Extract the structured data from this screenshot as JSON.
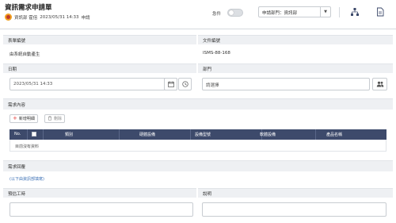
{
  "header": {
    "title": "資訊需求申請單",
    "user": "資訊部 霍倍",
    "datetime": "2023/05/31 14:33",
    "action": "申請",
    "urgent_label": "急件",
    "urgent_on": false,
    "dept_select": "申請部門：資訊部",
    "icons": [
      "org-chart-icon",
      "document-icon"
    ]
  },
  "fields": {
    "form_no_label": "表單編號",
    "form_no_value": "由系統自動產生",
    "doc_no_label": "文件編號",
    "doc_no_value": "ISMS-88-168",
    "date_label": "日期",
    "date_value": "2023/05/31 14:33",
    "dept_label": "部門",
    "dept_placeholder": "請選擇"
  },
  "request": {
    "section_label": "需求內容",
    "add_button": "新增明細",
    "delete_button": "刪除",
    "columns": [
      "No.",
      "",
      "類別",
      "硬體設備",
      "設備型號",
      "軟體設備",
      "產品名稱"
    ],
    "empty_text": "目前沒有資料"
  },
  "reply": {
    "section_label": "需求回覆",
    "note": "(以下由資訊部填寫)",
    "hours_label": "預估工時",
    "desc_label": "說明"
  },
  "colors": {
    "grid_header": "#3d4a6b",
    "section_bg": "#eef0f3",
    "note_text": "#3a6fb5",
    "add_plus": "#e53935"
  }
}
